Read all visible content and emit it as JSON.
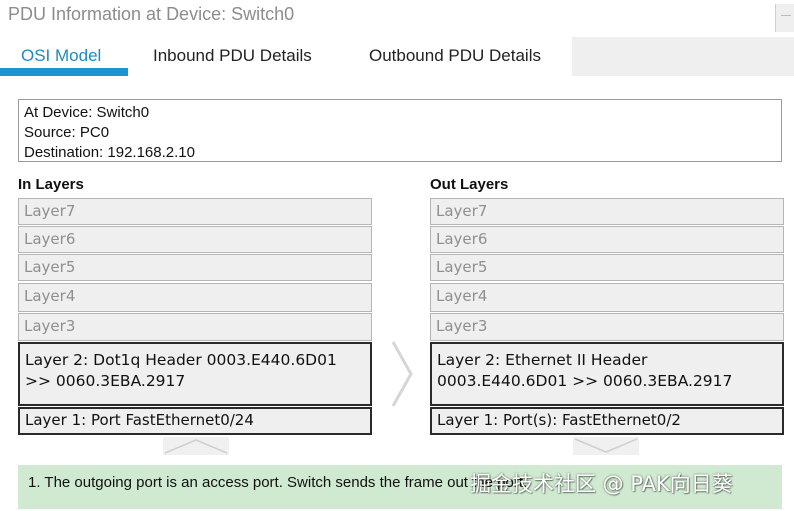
{
  "window": {
    "title": "PDU Information at Device: Switch0"
  },
  "tabs": [
    {
      "label": "OSI Model"
    },
    {
      "label": "Inbound PDU Details"
    },
    {
      "label": "Outbound PDU Details"
    }
  ],
  "info": {
    "device": "At Device: Switch0",
    "source": "Source: PC0",
    "destination": "Destination: 192.168.2.10"
  },
  "in_layers": {
    "heading": "In Layers",
    "items": [
      "Layer7",
      "Layer6",
      "Layer5",
      "Layer4",
      "Layer3",
      "Layer 2: Dot1q Header 0003.E440.6D01 >> 0060.3EBA.2917",
      "Layer 1: Port FastEthernet0/24"
    ]
  },
  "out_layers": {
    "heading": "Out Layers",
    "items": [
      "Layer7",
      "Layer6",
      "Layer5",
      "Layer4",
      "Layer3",
      "Layer 2: Ethernet II Header 0003.E440.6D01 >> 0060.3EBA.2917",
      "Layer 1: Port(s): FastEthernet0/2"
    ]
  },
  "status": {
    "text": "1. The outgoing port is an access port. Switch sends the frame out the port."
  },
  "watermark": "掘金技术社区 @ PAK向日葵",
  "colors": {
    "accent": "#1f93cf",
    "status_bg": "#cfead0",
    "layer_bg": "#efefef"
  },
  "icons": [
    "next-arrow-icon",
    "step-back-arrow-icon",
    "step-forward-arrow-icon"
  ]
}
